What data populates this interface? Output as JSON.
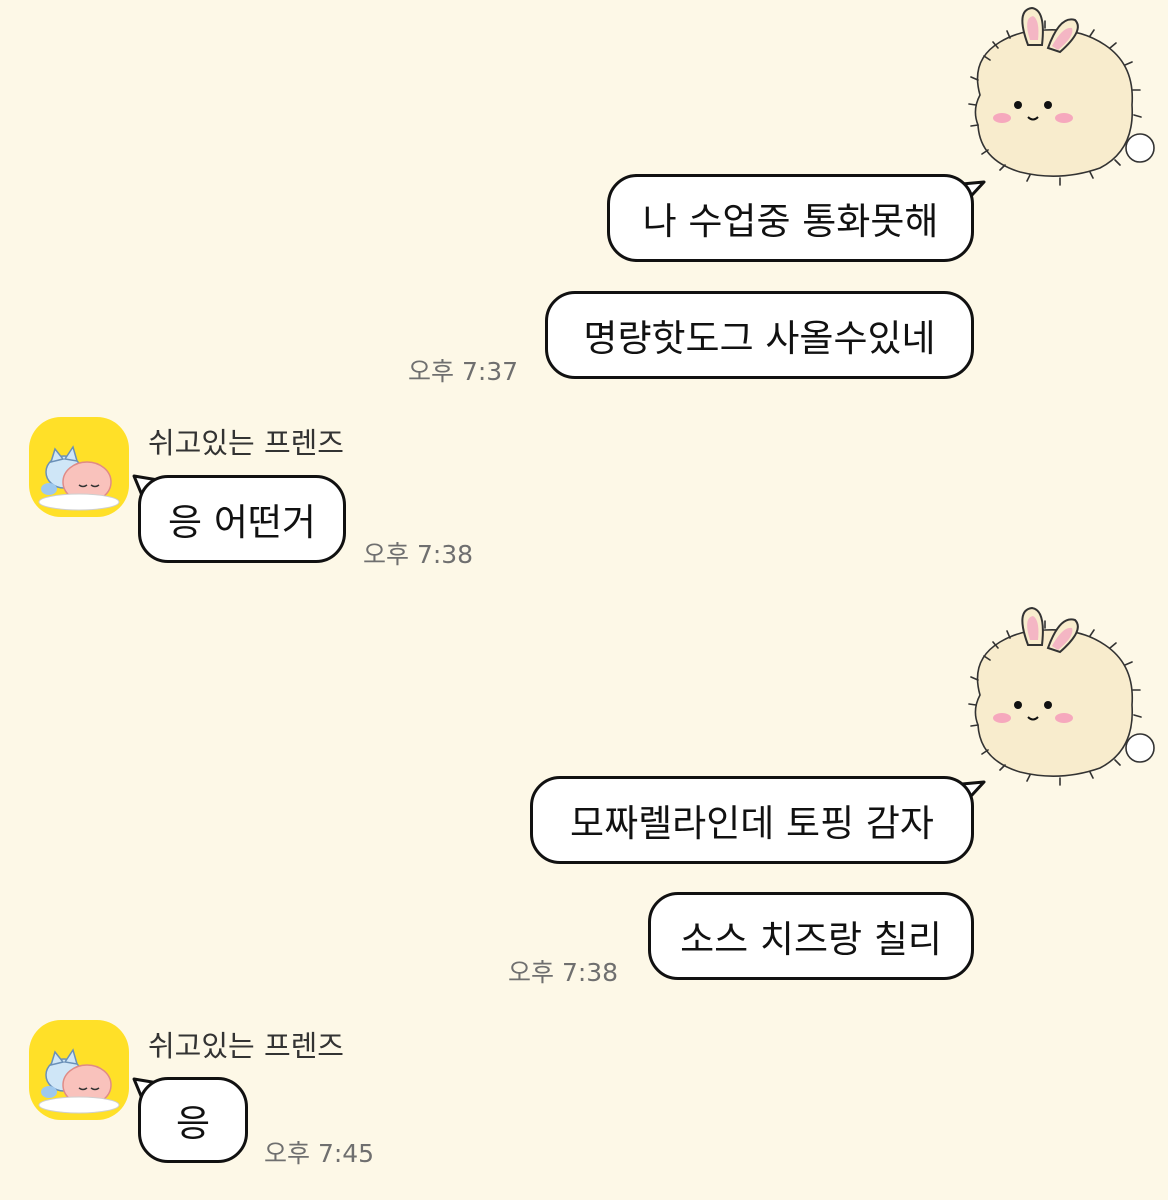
{
  "colors": {
    "background": "#fdf8e7",
    "bubble": "#ffffff",
    "bubble_border": "#111111",
    "avatar_bg": "#ffe028",
    "time_text": "#6f6f6f"
  },
  "conversation": {
    "block1": {
      "sticker": "fluffy-bunny-sticker",
      "messages": [
        "나 수업중 통화못해",
        "명량핫도그 사올수있네"
      ],
      "time": "오후 7:37"
    },
    "block2": {
      "sender": "쉬고있는 프렌즈",
      "avatar": "friends-sleeping-avatar",
      "message": "응 어떤거",
      "time": "오후 7:38"
    },
    "block3": {
      "sticker": "fluffy-bunny-sticker",
      "messages": [
        "모짜렐라인데 토핑 감자",
        "소스 치즈랑 칠리"
      ],
      "time": "오후 7:38"
    },
    "block4": {
      "sender": "쉬고있는 프렌즈",
      "avatar": "friends-sleeping-avatar",
      "message": "응",
      "time": "오후 7:45"
    }
  }
}
